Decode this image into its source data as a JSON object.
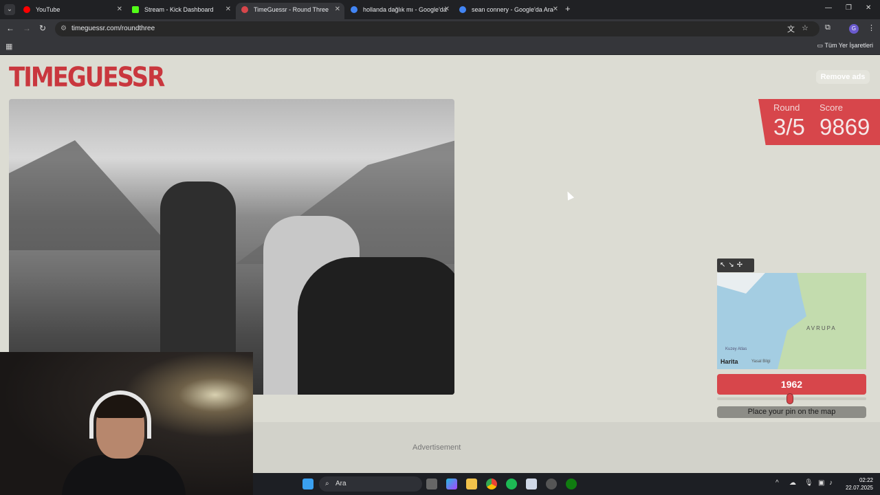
{
  "browser": {
    "tabs": [
      {
        "title": "YouTube",
        "favicon_color": "#ff0000",
        "active": false
      },
      {
        "title": "Stream - Kick Dashboard",
        "favicon_color": "#53fc18",
        "active": false
      },
      {
        "title": "TimeGuessr - Round Three",
        "favicon_color": "#d7464b",
        "active": true
      },
      {
        "title": "hollanda dağlık mı - Google'da",
        "favicon_color": "#4285f4",
        "active": false
      },
      {
        "title": "sean connery - Google'da Ara",
        "favicon_color": "#4285f4",
        "active": false
      }
    ],
    "url": "timeguessr.com/roundthree",
    "bookmarks_all": "Tüm Yer İşaretleri",
    "avatar_letter": "G"
  },
  "page": {
    "logo": "TIMEGUESSR",
    "remove_ads": "Remove ads",
    "round_label": "Round",
    "round_value": "3/5",
    "score_label": "Score",
    "score_value": "9869",
    "map_region_label": "AVRUPA",
    "map_small_label": "Kuzey Atlas",
    "map_brand": "Harita",
    "map_legal": "Yasal Bilgi",
    "year": "1962",
    "year_slider_fraction": 0.49,
    "place_pin": "Place your pin on the map",
    "advertisement": "Advertisement",
    "accent_color": "#d7464b"
  },
  "taskbar": {
    "search_placeholder": "Ara",
    "time": "02:22",
    "date": "22.07.2025"
  }
}
